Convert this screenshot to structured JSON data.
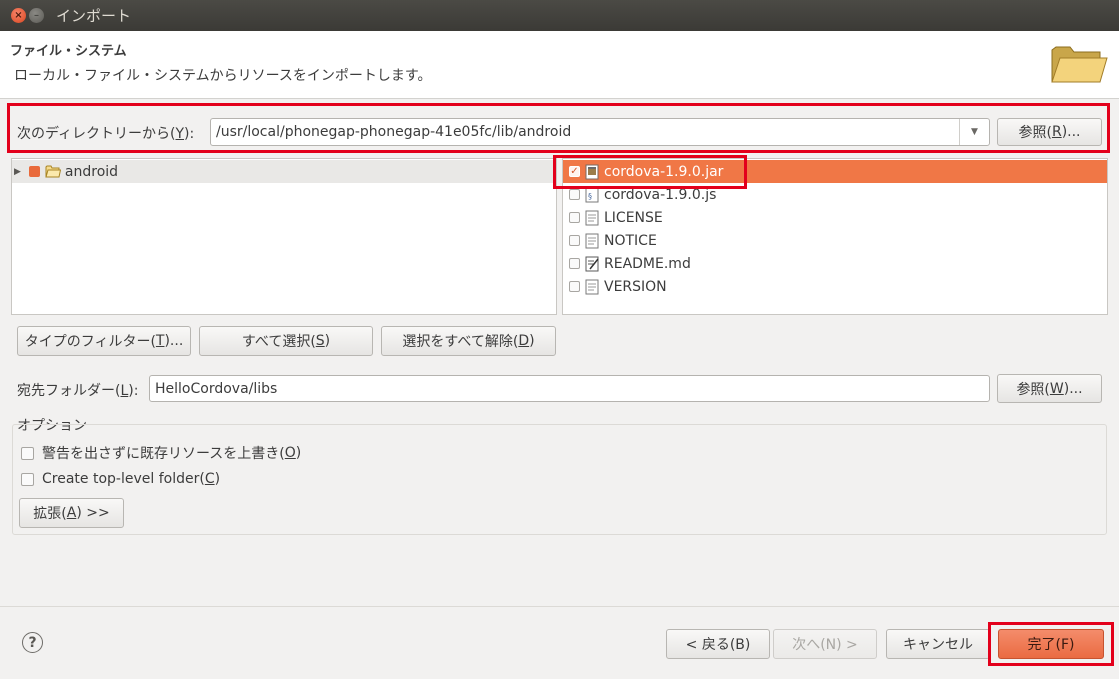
{
  "window": {
    "title": "インポート"
  },
  "header": {
    "title": "ファイル・システム",
    "description": "ローカル・ファイル・システムからリソースをインポートします。",
    "icon": "folder-icon"
  },
  "from_dir": {
    "label": "次のディレクトリーから(",
    "label_key": "Y",
    "label_end": "):",
    "value": "/usr/local/phonegap-phonegap-41e05fc/lib/android",
    "browse": {
      "pre": "参照(",
      "key": "R",
      "post": ")..."
    }
  },
  "tree": {
    "items": [
      {
        "label": "android",
        "expand_icon": "triangle-right-icon",
        "icon": "folder-icon"
      }
    ]
  },
  "files": {
    "items": [
      {
        "label": "cordova-1.9.0.jar",
        "checked": true,
        "selected": true,
        "icon": "jar-file-icon"
      },
      {
        "label": "cordova-1.9.0.js",
        "checked": false,
        "selected": false,
        "icon": "js-file-icon"
      },
      {
        "label": "LICENSE",
        "checked": false,
        "selected": false,
        "icon": "text-file-icon"
      },
      {
        "label": "NOTICE",
        "checked": false,
        "selected": false,
        "icon": "text-file-icon"
      },
      {
        "label": "README.md",
        "checked": false,
        "selected": false,
        "icon": "markdown-file-icon"
      },
      {
        "label": "VERSION",
        "checked": false,
        "selected": false,
        "icon": "text-file-icon"
      }
    ]
  },
  "selection_buttons": {
    "filter": {
      "pre": "タイプのフィルター(",
      "key": "T",
      "post": ")..."
    },
    "select_all": {
      "pre": "すべて選択(",
      "key": "S",
      "post": ")"
    },
    "deselect_all": {
      "pre": "選択をすべて解除(",
      "key": "D",
      "post": ")"
    }
  },
  "dest": {
    "label_pre": "宛先フォルダー(",
    "label_key": "L",
    "label_post": "):",
    "value": "HelloCordova/libs",
    "browse": {
      "pre": "参照(",
      "key": "W",
      "post": ")..."
    }
  },
  "options": {
    "legend": "オプション",
    "overwrite": {
      "pre": "警告を出さずに既存リソースを上書き(",
      "key": "O",
      "post": ")",
      "checked": false
    },
    "toplevel": {
      "pre": "Create top-level folder(",
      "key": "C",
      "post": ")",
      "checked": false
    },
    "advanced": {
      "pre": "拡張(",
      "key": "A",
      "post": ") >>"
    }
  },
  "footer": {
    "help_icon": "help-icon",
    "back": "< 戻る(B)",
    "next": "次へ(N) >",
    "cancel": "キャンセル",
    "finish": "完了(F)"
  },
  "colors": {
    "accent": "#f07746",
    "highlight_box": "#e3001b",
    "selection": "#f07746"
  }
}
